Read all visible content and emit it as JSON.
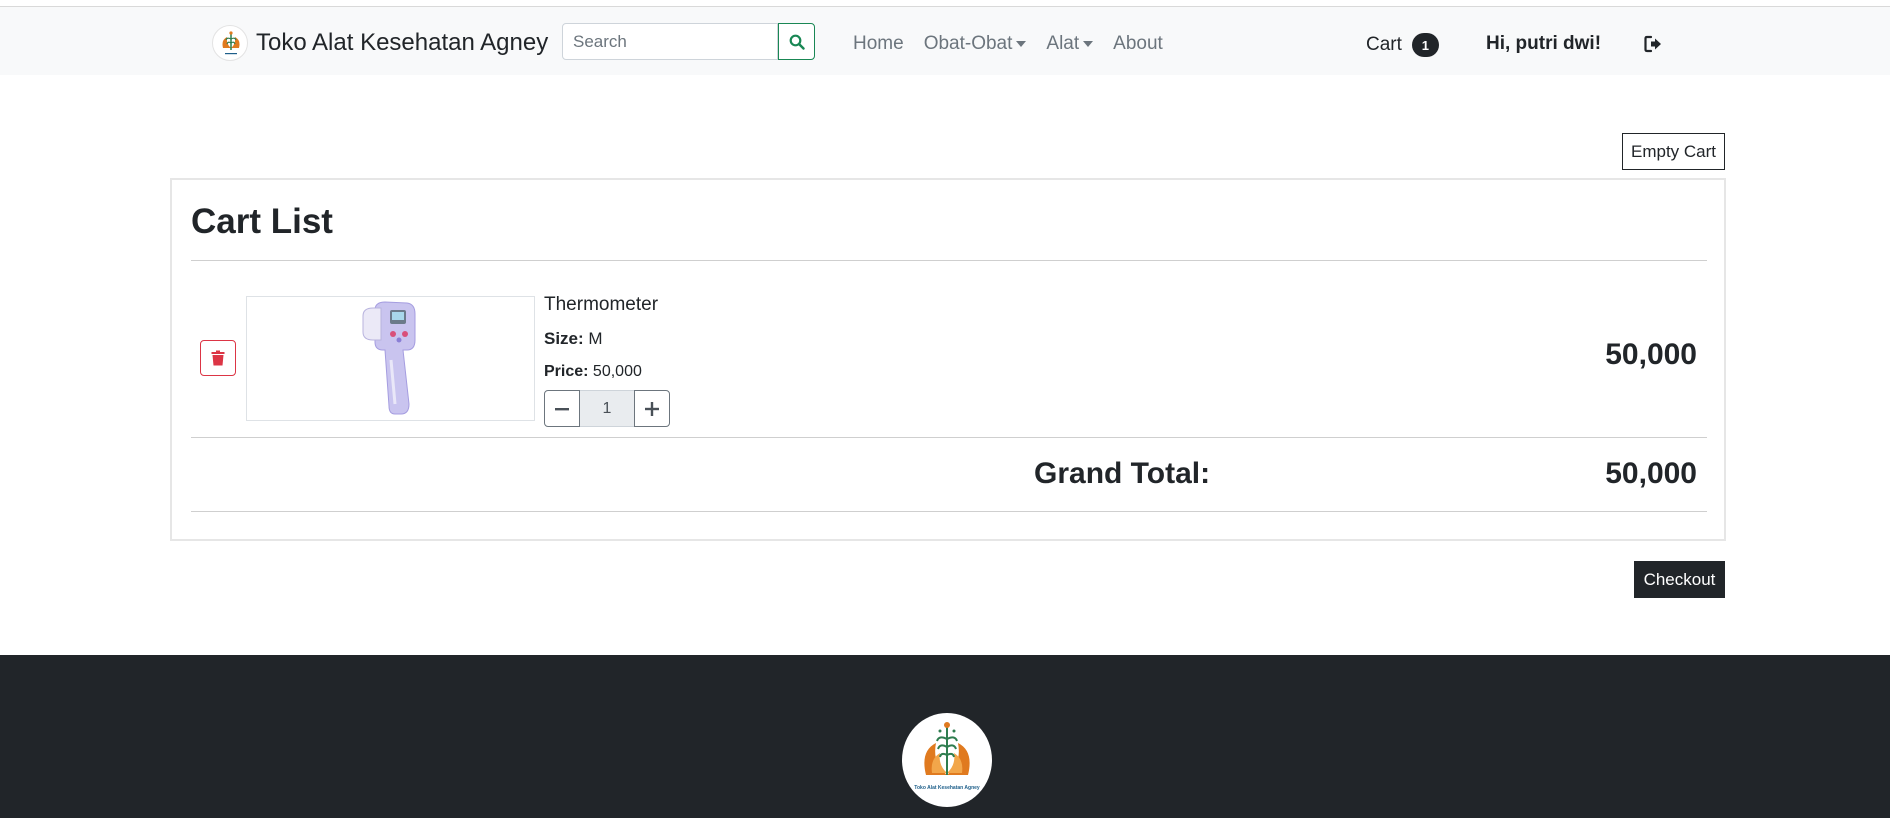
{
  "navbar": {
    "brand": "Toko Alat Kesehatan Agney",
    "search_placeholder": "Search",
    "links": [
      "Home",
      "Obat-Obat",
      "Alat",
      "About"
    ],
    "cart_label": "Cart",
    "cart_count": "1",
    "greeting": "Hi, putri dwi!"
  },
  "actions": {
    "empty_cart": "Empty Cart",
    "checkout": "Checkout"
  },
  "cart": {
    "title": "Cart List",
    "items": [
      {
        "name": "Thermometer",
        "size_label": "Size:",
        "size": "M",
        "price_label": "Price:",
        "price": "50,000",
        "quantity": "1",
        "total": "50,000"
      }
    ],
    "grand_total_label": "Grand Total:",
    "grand_total": "50,000"
  },
  "footer": {
    "logo_text": "Toko Alat Kesehatan Agney"
  },
  "colors": {
    "danger": "#dc3545",
    "success": "#198754",
    "dark": "#212529",
    "navbar_bg": "#f8f9fa"
  },
  "icons": [
    "search-icon",
    "trash-icon",
    "minus-icon",
    "plus-icon",
    "logout-icon"
  ]
}
